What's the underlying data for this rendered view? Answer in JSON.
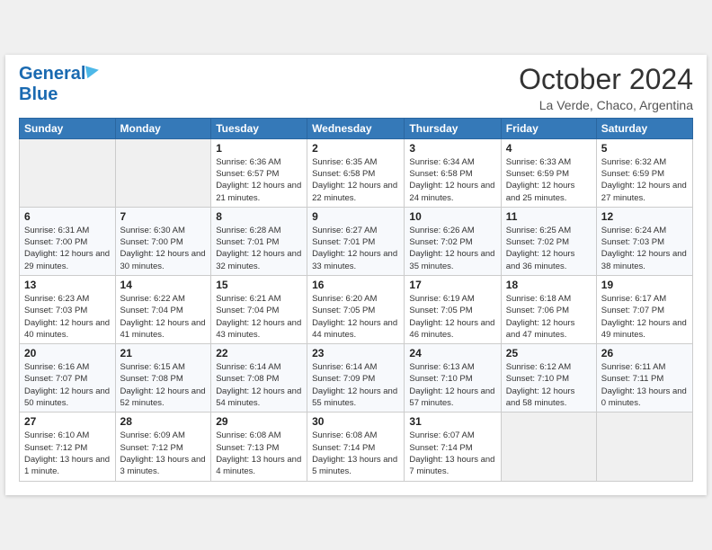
{
  "header": {
    "logo_line1": "General",
    "logo_line2": "Blue",
    "month": "October 2024",
    "location": "La Verde, Chaco, Argentina"
  },
  "weekdays": [
    "Sunday",
    "Monday",
    "Tuesday",
    "Wednesday",
    "Thursday",
    "Friday",
    "Saturday"
  ],
  "weeks": [
    [
      {
        "num": "",
        "empty": true
      },
      {
        "num": "",
        "empty": true
      },
      {
        "num": "1",
        "sunrise": "6:36 AM",
        "sunset": "6:57 PM",
        "daylight": "12 hours and 21 minutes."
      },
      {
        "num": "2",
        "sunrise": "6:35 AM",
        "sunset": "6:58 PM",
        "daylight": "12 hours and 22 minutes."
      },
      {
        "num": "3",
        "sunrise": "6:34 AM",
        "sunset": "6:58 PM",
        "daylight": "12 hours and 24 minutes."
      },
      {
        "num": "4",
        "sunrise": "6:33 AM",
        "sunset": "6:59 PM",
        "daylight": "12 hours and 25 minutes."
      },
      {
        "num": "5",
        "sunrise": "6:32 AM",
        "sunset": "6:59 PM",
        "daylight": "12 hours and 27 minutes."
      }
    ],
    [
      {
        "num": "6",
        "sunrise": "6:31 AM",
        "sunset": "7:00 PM",
        "daylight": "12 hours and 29 minutes."
      },
      {
        "num": "7",
        "sunrise": "6:30 AM",
        "sunset": "7:00 PM",
        "daylight": "12 hours and 30 minutes."
      },
      {
        "num": "8",
        "sunrise": "6:28 AM",
        "sunset": "7:01 PM",
        "daylight": "12 hours and 32 minutes."
      },
      {
        "num": "9",
        "sunrise": "6:27 AM",
        "sunset": "7:01 PM",
        "daylight": "12 hours and 33 minutes."
      },
      {
        "num": "10",
        "sunrise": "6:26 AM",
        "sunset": "7:02 PM",
        "daylight": "12 hours and 35 minutes."
      },
      {
        "num": "11",
        "sunrise": "6:25 AM",
        "sunset": "7:02 PM",
        "daylight": "12 hours and 36 minutes."
      },
      {
        "num": "12",
        "sunrise": "6:24 AM",
        "sunset": "7:03 PM",
        "daylight": "12 hours and 38 minutes."
      }
    ],
    [
      {
        "num": "13",
        "sunrise": "6:23 AM",
        "sunset": "7:03 PM",
        "daylight": "12 hours and 40 minutes."
      },
      {
        "num": "14",
        "sunrise": "6:22 AM",
        "sunset": "7:04 PM",
        "daylight": "12 hours and 41 minutes."
      },
      {
        "num": "15",
        "sunrise": "6:21 AM",
        "sunset": "7:04 PM",
        "daylight": "12 hours and 43 minutes."
      },
      {
        "num": "16",
        "sunrise": "6:20 AM",
        "sunset": "7:05 PM",
        "daylight": "12 hours and 44 minutes."
      },
      {
        "num": "17",
        "sunrise": "6:19 AM",
        "sunset": "7:05 PM",
        "daylight": "12 hours and 46 minutes."
      },
      {
        "num": "18",
        "sunrise": "6:18 AM",
        "sunset": "7:06 PM",
        "daylight": "12 hours and 47 minutes."
      },
      {
        "num": "19",
        "sunrise": "6:17 AM",
        "sunset": "7:07 PM",
        "daylight": "12 hours and 49 minutes."
      }
    ],
    [
      {
        "num": "20",
        "sunrise": "6:16 AM",
        "sunset": "7:07 PM",
        "daylight": "12 hours and 50 minutes."
      },
      {
        "num": "21",
        "sunrise": "6:15 AM",
        "sunset": "7:08 PM",
        "daylight": "12 hours and 52 minutes."
      },
      {
        "num": "22",
        "sunrise": "6:14 AM",
        "sunset": "7:08 PM",
        "daylight": "12 hours and 54 minutes."
      },
      {
        "num": "23",
        "sunrise": "6:14 AM",
        "sunset": "7:09 PM",
        "daylight": "12 hours and 55 minutes."
      },
      {
        "num": "24",
        "sunrise": "6:13 AM",
        "sunset": "7:10 PM",
        "daylight": "12 hours and 57 minutes."
      },
      {
        "num": "25",
        "sunrise": "6:12 AM",
        "sunset": "7:10 PM",
        "daylight": "12 hours and 58 minutes."
      },
      {
        "num": "26",
        "sunrise": "6:11 AM",
        "sunset": "7:11 PM",
        "daylight": "13 hours and 0 minutes."
      }
    ],
    [
      {
        "num": "27",
        "sunrise": "6:10 AM",
        "sunset": "7:12 PM",
        "daylight": "13 hours and 1 minute."
      },
      {
        "num": "28",
        "sunrise": "6:09 AM",
        "sunset": "7:12 PM",
        "daylight": "13 hours and 3 minutes."
      },
      {
        "num": "29",
        "sunrise": "6:08 AM",
        "sunset": "7:13 PM",
        "daylight": "13 hours and 4 minutes."
      },
      {
        "num": "30",
        "sunrise": "6:08 AM",
        "sunset": "7:14 PM",
        "daylight": "13 hours and 5 minutes."
      },
      {
        "num": "31",
        "sunrise": "6:07 AM",
        "sunset": "7:14 PM",
        "daylight": "13 hours and 7 minutes."
      },
      {
        "num": "",
        "empty": true
      },
      {
        "num": "",
        "empty": true
      }
    ]
  ],
  "labels": {
    "sunrise": "Sunrise:",
    "sunset": "Sunset:",
    "daylight": "Daylight:"
  }
}
